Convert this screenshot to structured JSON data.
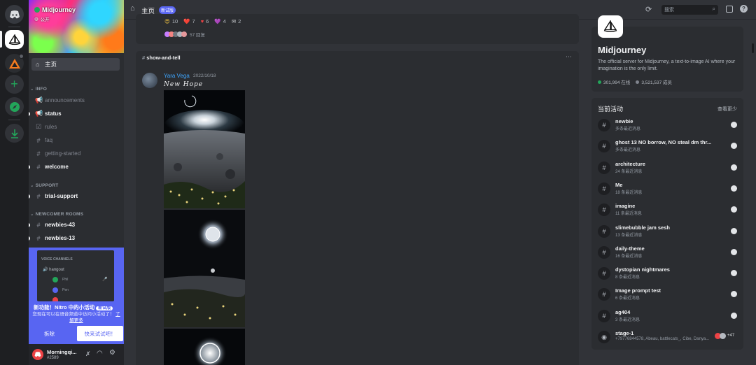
{
  "header": {
    "title": "主页",
    "badge": "新试版",
    "search_placeholder": "搜索"
  },
  "server": {
    "name": "Midjourney",
    "visibility": "公开",
    "home_label": "主页"
  },
  "sidebar": {
    "categories": [
      "INFO",
      "SUPPORT",
      "NEWCOMER ROOMS"
    ],
    "info_channels": [
      {
        "label": "announcements",
        "unread": false
      },
      {
        "label": "status",
        "unread": true
      },
      {
        "label": "rules",
        "unread": false
      },
      {
        "label": "faq",
        "unread": false
      },
      {
        "label": "getting-started",
        "unread": false
      },
      {
        "label": "welcome",
        "unread": true
      }
    ],
    "support_channels": [
      {
        "label": "trial-support",
        "unread": true
      }
    ],
    "newcomer_channels": [
      {
        "label": "newbies-43",
        "unread": true
      },
      {
        "label": "newbies-13",
        "unread": true
      }
    ]
  },
  "promo": {
    "preview_category": "VOICE CHANNELS",
    "preview_channel": "hangout",
    "preview_users": [
      "Phil",
      "Pen",
      "Ribie"
    ],
    "title": "新功能！Nitro 中的小活动",
    "badge": "新试版",
    "body": "您现在可以在语音频道中访问小活动了！",
    "link": "了解更多",
    "dismiss": "拆除",
    "try": "快来试试吧！"
  },
  "user": {
    "name": "Morningqi...",
    "tag": "#2589"
  },
  "feed": {
    "reactions": [
      {
        "icon": "😍",
        "count": "10"
      },
      {
        "icon": "❤️",
        "count": "7"
      },
      {
        "icon": "♥",
        "count": "6"
      },
      {
        "icon": "💜",
        "count": "4"
      },
      {
        "icon": "✉",
        "count": "2"
      }
    ],
    "replies": "57 回复",
    "post": {
      "channel": "show-and-tell",
      "author": "Yara Vega",
      "date": "2022/10/18",
      "caption": "New Hope"
    }
  },
  "about": {
    "name": "Midjourney",
    "description": "The official server for Midjourney, a text-to-image AI where your imagination is the only limit.",
    "online": "301,994 在线",
    "members": "3,521,537 成员"
  },
  "activity": {
    "title": "当前活动",
    "see_less": "查看更少",
    "items": [
      {
        "name": "newbie",
        "sub": "多条最近消息",
        "icon": "#"
      },
      {
        "name": "ghost 13 NO borrow, NO steal dm thr...",
        "sub": "多条最近消息",
        "icon": "#"
      },
      {
        "name": "architecture",
        "sub": "24 条最近消息",
        "icon": "#"
      },
      {
        "name": "Me",
        "sub": "18 条最近消息",
        "icon": "#"
      },
      {
        "name": "imagine",
        "sub": "11 条最近消息",
        "icon": "#"
      },
      {
        "name": "slimebubble jam sesh",
        "sub": "13 条最近消息",
        "icon": "#"
      },
      {
        "name": "daily-theme",
        "sub": "16 条最近消息",
        "icon": "#"
      },
      {
        "name": "dystopian nightmares",
        "sub": "8 条最近消息",
        "icon": "#"
      },
      {
        "name": "Image prompt test",
        "sub": "6 条最近消息",
        "icon": "#"
      },
      {
        "name": "ag404",
        "sub": "3 条最近消息",
        "icon": "#"
      },
      {
        "name": "stage-1",
        "sub": "+79776844578, Abeau, battlecats_, Cibe, Danya...",
        "icon": "◉"
      }
    ],
    "stage_extra": "+47"
  },
  "colors": {
    "accent": "#5865f2",
    "online": "#23a55a",
    "brand_red": "#ed4245"
  }
}
